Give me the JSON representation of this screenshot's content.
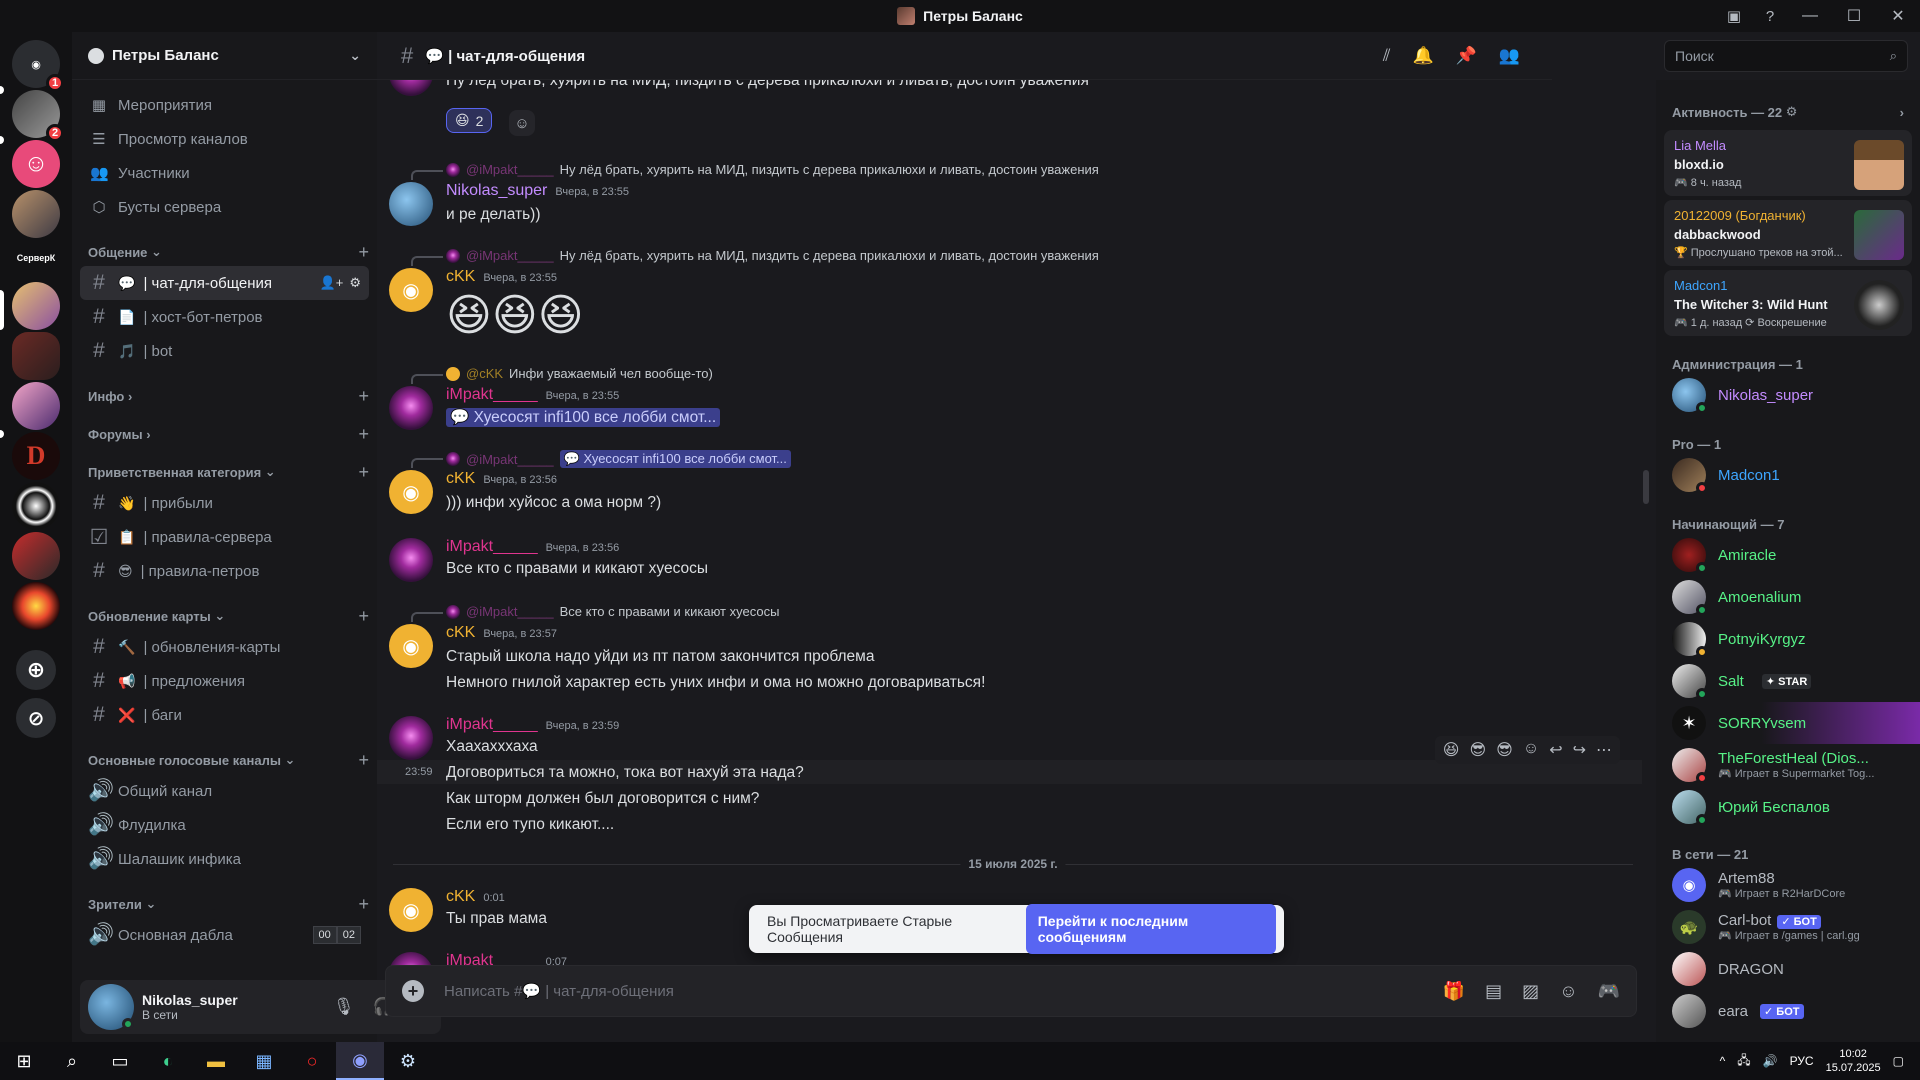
{
  "window": {
    "title": "Петры Баланс"
  },
  "server": {
    "name": "Петры Баланс"
  },
  "nav": [
    {
      "label": "Мероприятия",
      "icon": "calendar-icon"
    },
    {
      "label": "Просмотр каналов",
      "icon": "channels-icon"
    },
    {
      "label": "Участники",
      "icon": "members-icon"
    },
    {
      "label": "Бусты сервера",
      "icon": "boost-icon"
    }
  ],
  "categories": {
    "obsch": {
      "label": "Общение"
    },
    "info": {
      "label": "Инфо"
    },
    "forums": {
      "label": "Форумы"
    },
    "welcome": {
      "label": "Приветственная категория"
    },
    "mapupd": {
      "label": "Обновление карты"
    },
    "voice": {
      "label": "Основные голосовые каналы"
    },
    "viewers": {
      "label": "Зрители"
    }
  },
  "channels": {
    "chat": {
      "emoji": "💬",
      "label": "| чат-для-общения"
    },
    "host": {
      "emoji": "📄",
      "label": "| хост-бот-петров"
    },
    "bot": {
      "emoji": "🎵",
      "label": "| bot"
    },
    "arrived": {
      "emoji": "👋",
      "label": "| прибыли"
    },
    "rules": {
      "emoji": "📋",
      "label": "| правила-сервера"
    },
    "rulesp": {
      "emoji": "😎",
      "label": "| правила-петров"
    },
    "upd": {
      "emoji": "🔨",
      "label": "| обновления-карты"
    },
    "sugg": {
      "emoji": "📢",
      "label": "| предложения"
    },
    "bugs": {
      "emoji": "❌",
      "label": "| баги"
    },
    "v1": {
      "label": "Общий канал"
    },
    "v2": {
      "label": "Флудилка"
    },
    "v3": {
      "label": "Шалашик инфика"
    },
    "v4": {
      "label": "Основная дабла",
      "count_a": "00",
      "count_b": "02"
    }
  },
  "user": {
    "name": "Nikolas_super",
    "status": "В сети"
  },
  "guild_badges": {
    "home": "1",
    "g2": "2"
  },
  "guild_label": "СерверК",
  "chat_header": {
    "emoji": "💬",
    "name": "| чат-для-общения"
  },
  "search": {
    "placeholder": "Поиск"
  },
  "messages": {
    "m0": {
      "text": "Ну лёд брать, хуярить на МИД, пиздить с дерева прикалюхи и ливать, достоин уважения",
      "reaction_count": "2"
    },
    "m1": {
      "reply_name": "@iMpakt_____",
      "reply_text": "Ну лёд брать, хуярить на МИД, пиздить с дерева прикалюхи и ливать, достоин уважения",
      "author": "Nikolas_super",
      "time": "Вчера, в 23:55",
      "text": "и ре делать))"
    },
    "m2": {
      "reply_name": "@iMpakt_____",
      "reply_text": "Ну лёд брать, хуярить на МИД, пиздить с дерева прикалюхи и ливать, достоин уважения",
      "author": "cKK",
      "time": "Вчера, в 23:55",
      "emojis": "😆😆😆"
    },
    "m3": {
      "reply_name": "@cKK",
      "reply_text": "Инфи уважаемый чел вообще-то)",
      "author": "iMpakt_____",
      "time": "Вчера, в 23:55",
      "text": "Хуесосят infi100 все лобби смот..."
    },
    "m4": {
      "reply_name": "@iMpakt_____",
      "reply_text": "Хуесосят infi100 все лобби смот...",
      "author": "cKK",
      "time": "Вчера, в 23:56",
      "text": "))) инфи хуйсос а ома норм ?)"
    },
    "m5": {
      "author": "iMpakt_____",
      "time": "Вчера, в 23:56",
      "text": "Все кто с правами и кикают хуесосы"
    },
    "m6": {
      "reply_name": "@iMpakt_____",
      "reply_text": "Все кто с правами и кикают хуесосы",
      "author": "cKK",
      "time": "Вчера, в 23:57",
      "text": "Старый школа надо уйди из пт патом закончится проблема",
      "text2": "Немного гнилой характер есть уних инфи и ома но можно договариваться!"
    },
    "m7": {
      "author": "iMpakt_____",
      "time": "Вчера, в 23:59",
      "text": "Хаахахххаха",
      "hover_time": "23:59",
      "text2": "Договориться та можно, тока вот нахуй эта нада?",
      "text3": "Как шторм должен был договорится с ним?",
      "text4": "Если его тупо кикают...."
    },
    "date_divider": "15 июля 2025 г.",
    "m8": {
      "author": "cKK",
      "time": "0:01",
      "text": "Ты прав мама"
    },
    "m9": {
      "author": "iMpakt_____",
      "time": "0:07"
    }
  },
  "old_messages": {
    "text": "Вы Просматриваете Старые Сообщения",
    "button": "Перейти к последним сообщениям"
  },
  "composer": {
    "placeholder_prefix": "Написать #💬",
    "placeholder_channel": "| чат-для-общения"
  },
  "members": {
    "activity_header": "Активность — 22",
    "activities": [
      {
        "name": "Lia Mella",
        "title": "bloxd.io",
        "sub": "8 ч. назад",
        "color": "#c38cff"
      },
      {
        "name": "20122009 (Богданчик)",
        "title": "dabbackwood",
        "sub": "Прослушано треков на этой...",
        "color": "#f0b232"
      },
      {
        "name": "Madcon1",
        "title": "The Witcher 3: Wild Hunt",
        "sub": "1 д. назад  ⟳ Воскрешение",
        "color": "#3ea6ff"
      }
    ],
    "admin_header": "Администрация — 1",
    "admin": {
      "name": "Nikolas_super"
    },
    "pro_header": "Pro — 1",
    "pro": {
      "name": "Madcon1"
    },
    "beg_header": "Начинающий — 7",
    "beginners": [
      {
        "name": "Amiracle",
        "color": "#57f287"
      },
      {
        "name": "Amoenalium",
        "color": "#57f287"
      },
      {
        "name": "PotnyiKyrgyz",
        "color": "#57f287"
      },
      {
        "name": "Salt",
        "color": "#57f287",
        "tag": "STAR"
      },
      {
        "name": "SORRYvsem",
        "color": "#57f287"
      },
      {
        "name": "TheForestHeal (Dios...",
        "color": "#57f287",
        "sub": "Играет в Supermarket Tog..."
      },
      {
        "name": "Юрий Беспалов",
        "color": "#57f287"
      }
    ],
    "online_header": "В сети — 21",
    "online": [
      {
        "name": "Artem88",
        "sub": "Играет в R2HarDCore"
      },
      {
        "name": "Carl-bot",
        "tag": "✓ БОТ",
        "sub": "Играет в /games | carl.gg"
      },
      {
        "name": "DRAGON"
      },
      {
        "name": "eara",
        "tag": "✓ БОТ"
      }
    ]
  },
  "taskbar": {
    "lang": "РУС",
    "time": "10:02",
    "date": "15.07.2025"
  },
  "colors": {
    "accent": "#5865f2",
    "impakt": "#e0358f",
    "ckk": "#f0b232",
    "nikolas": "#c38cff",
    "online": "#23a55a",
    "dnd": "#f23f43"
  }
}
